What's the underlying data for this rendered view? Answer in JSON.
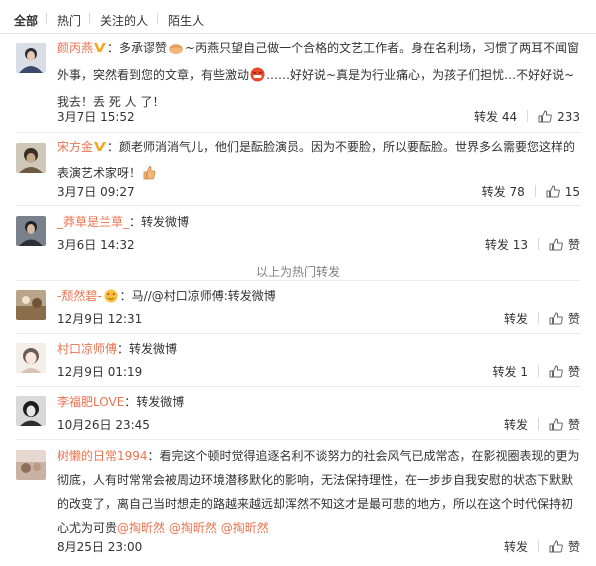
{
  "tabs": [
    "全部",
    "热门",
    "关注的人",
    "陌生人"
  ],
  "hot_separator": "以上为热门转发",
  "actions": {
    "repost_label": "转发",
    "like_label": "赞"
  },
  "comments": [
    {
      "name": "颜丙燕",
      "verified": true,
      "text": "：多承谬赞~丙燕只望自己做一个合格的文艺工作者。身在名利场，习惯了两耳不闻窗外事，突然看到您的文章，有些激动……好好说~真是为行业痛心，为孩子们担忧…不好好说~我去！丢 死 人 了！",
      "time": "3月7日 15:52",
      "repost_count": "44",
      "like_count": "233",
      "avatar_color": "#3b4a6b"
    },
    {
      "name": "宋方金",
      "verified": true,
      "text": "：颜老师消消气儿，他们是酝脸演员。因为不要脸，所以要酝脸。世界多么需要您这样的表演艺术家呀！",
      "time": "3月7日 09:27",
      "repost_count": "78",
      "like_count": "15",
      "avatar_color": "#6b5a44"
    },
    {
      "name": "_莽草是兰草_",
      "verified": false,
      "text": "：转发微博",
      "time": "3月6日 14:32",
      "repost_count": "13",
      "like_count": "赞",
      "avatar_color": "#4a4f5a"
    },
    {
      "name": "-颓然碧-",
      "verified": false,
      "text": "：马//@村口凉师傅:转发微博",
      "mention": "@村口凉师傅",
      "time": "12月9日 12:31",
      "repost_count": "",
      "like_count": "赞",
      "avatar_color": "#8a6e4b"
    },
    {
      "name": "村口凉师傅",
      "verified": false,
      "text": "：转发微博",
      "time": "12月9日 01:19",
      "repost_count": "1",
      "like_count": "赞",
      "avatar_color": "#e9dcd0"
    },
    {
      "name": "李福肥LOVE",
      "verified": false,
      "text": "：转发微博",
      "time": "10月26日 23:45",
      "repost_count": "",
      "like_count": "赞",
      "avatar_color": "#2e2e2e"
    },
    {
      "name": "树懒的日常1994",
      "verified": false,
      "text": "：看完这个顿时觉得追逐名利不谈努力的社会风气已成常态，在影视圈表现的更为彻底，人有时常常会被周边环境潜移默化的影响，无法保持理性，在一步步自我安慰的状态下默默的改变了，离自己当时想走的路越来越远却浑然不知这才是最可悲的地方，所以在这个时代保持初心尤为可贵",
      "mentions": [
        "@掏昕然",
        "@掏昕然",
        "@掏昕然"
      ],
      "time": "8月25日 23:00",
      "repost_count": "",
      "like_count": "赞",
      "avatar_color": "#b79a86"
    }
  ]
}
